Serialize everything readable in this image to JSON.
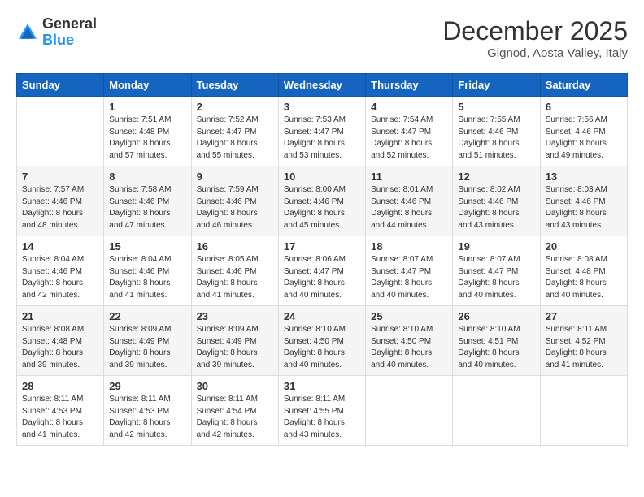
{
  "header": {
    "logo_line1": "General",
    "logo_line2": "Blue",
    "month_title": "December 2025",
    "location": "Gignod, Aosta Valley, Italy"
  },
  "days_of_week": [
    "Sunday",
    "Monday",
    "Tuesday",
    "Wednesday",
    "Thursday",
    "Friday",
    "Saturday"
  ],
  "weeks": [
    [
      {
        "day": "",
        "sunrise": "",
        "sunset": "",
        "daylight": ""
      },
      {
        "day": "1",
        "sunrise": "Sunrise: 7:51 AM",
        "sunset": "Sunset: 4:48 PM",
        "daylight": "Daylight: 8 hours and 57 minutes."
      },
      {
        "day": "2",
        "sunrise": "Sunrise: 7:52 AM",
        "sunset": "Sunset: 4:47 PM",
        "daylight": "Daylight: 8 hours and 55 minutes."
      },
      {
        "day": "3",
        "sunrise": "Sunrise: 7:53 AM",
        "sunset": "Sunset: 4:47 PM",
        "daylight": "Daylight: 8 hours and 53 minutes."
      },
      {
        "day": "4",
        "sunrise": "Sunrise: 7:54 AM",
        "sunset": "Sunset: 4:47 PM",
        "daylight": "Daylight: 8 hours and 52 minutes."
      },
      {
        "day": "5",
        "sunrise": "Sunrise: 7:55 AM",
        "sunset": "Sunset: 4:46 PM",
        "daylight": "Daylight: 8 hours and 51 minutes."
      },
      {
        "day": "6",
        "sunrise": "Sunrise: 7:56 AM",
        "sunset": "Sunset: 4:46 PM",
        "daylight": "Daylight: 8 hours and 49 minutes."
      }
    ],
    [
      {
        "day": "7",
        "sunrise": "Sunrise: 7:57 AM",
        "sunset": "Sunset: 4:46 PM",
        "daylight": "Daylight: 8 hours and 48 minutes."
      },
      {
        "day": "8",
        "sunrise": "Sunrise: 7:58 AM",
        "sunset": "Sunset: 4:46 PM",
        "daylight": "Daylight: 8 hours and 47 minutes."
      },
      {
        "day": "9",
        "sunrise": "Sunrise: 7:59 AM",
        "sunset": "Sunset: 4:46 PM",
        "daylight": "Daylight: 8 hours and 46 minutes."
      },
      {
        "day": "10",
        "sunrise": "Sunrise: 8:00 AM",
        "sunset": "Sunset: 4:46 PM",
        "daylight": "Daylight: 8 hours and 45 minutes."
      },
      {
        "day": "11",
        "sunrise": "Sunrise: 8:01 AM",
        "sunset": "Sunset: 4:46 PM",
        "daylight": "Daylight: 8 hours and 44 minutes."
      },
      {
        "day": "12",
        "sunrise": "Sunrise: 8:02 AM",
        "sunset": "Sunset: 4:46 PM",
        "daylight": "Daylight: 8 hours and 43 minutes."
      },
      {
        "day": "13",
        "sunrise": "Sunrise: 8:03 AM",
        "sunset": "Sunset: 4:46 PM",
        "daylight": "Daylight: 8 hours and 43 minutes."
      }
    ],
    [
      {
        "day": "14",
        "sunrise": "Sunrise: 8:04 AM",
        "sunset": "Sunset: 4:46 PM",
        "daylight": "Daylight: 8 hours and 42 minutes."
      },
      {
        "day": "15",
        "sunrise": "Sunrise: 8:04 AM",
        "sunset": "Sunset: 4:46 PM",
        "daylight": "Daylight: 8 hours and 41 minutes."
      },
      {
        "day": "16",
        "sunrise": "Sunrise: 8:05 AM",
        "sunset": "Sunset: 4:46 PM",
        "daylight": "Daylight: 8 hours and 41 minutes."
      },
      {
        "day": "17",
        "sunrise": "Sunrise: 8:06 AM",
        "sunset": "Sunset: 4:47 PM",
        "daylight": "Daylight: 8 hours and 40 minutes."
      },
      {
        "day": "18",
        "sunrise": "Sunrise: 8:07 AM",
        "sunset": "Sunset: 4:47 PM",
        "daylight": "Daylight: 8 hours and 40 minutes."
      },
      {
        "day": "19",
        "sunrise": "Sunrise: 8:07 AM",
        "sunset": "Sunset: 4:47 PM",
        "daylight": "Daylight: 8 hours and 40 minutes."
      },
      {
        "day": "20",
        "sunrise": "Sunrise: 8:08 AM",
        "sunset": "Sunset: 4:48 PM",
        "daylight": "Daylight: 8 hours and 40 minutes."
      }
    ],
    [
      {
        "day": "21",
        "sunrise": "Sunrise: 8:08 AM",
        "sunset": "Sunset: 4:48 PM",
        "daylight": "Daylight: 8 hours and 39 minutes."
      },
      {
        "day": "22",
        "sunrise": "Sunrise: 8:09 AM",
        "sunset": "Sunset: 4:49 PM",
        "daylight": "Daylight: 8 hours and 39 minutes."
      },
      {
        "day": "23",
        "sunrise": "Sunrise: 8:09 AM",
        "sunset": "Sunset: 4:49 PM",
        "daylight": "Daylight: 8 hours and 39 minutes."
      },
      {
        "day": "24",
        "sunrise": "Sunrise: 8:10 AM",
        "sunset": "Sunset: 4:50 PM",
        "daylight": "Daylight: 8 hours and 40 minutes."
      },
      {
        "day": "25",
        "sunrise": "Sunrise: 8:10 AM",
        "sunset": "Sunset: 4:50 PM",
        "daylight": "Daylight: 8 hours and 40 minutes."
      },
      {
        "day": "26",
        "sunrise": "Sunrise: 8:10 AM",
        "sunset": "Sunset: 4:51 PM",
        "daylight": "Daylight: 8 hours and 40 minutes."
      },
      {
        "day": "27",
        "sunrise": "Sunrise: 8:11 AM",
        "sunset": "Sunset: 4:52 PM",
        "daylight": "Daylight: 8 hours and 41 minutes."
      }
    ],
    [
      {
        "day": "28",
        "sunrise": "Sunrise: 8:11 AM",
        "sunset": "Sunset: 4:53 PM",
        "daylight": "Daylight: 8 hours and 41 minutes."
      },
      {
        "day": "29",
        "sunrise": "Sunrise: 8:11 AM",
        "sunset": "Sunset: 4:53 PM",
        "daylight": "Daylight: 8 hours and 42 minutes."
      },
      {
        "day": "30",
        "sunrise": "Sunrise: 8:11 AM",
        "sunset": "Sunset: 4:54 PM",
        "daylight": "Daylight: 8 hours and 42 minutes."
      },
      {
        "day": "31",
        "sunrise": "Sunrise: 8:11 AM",
        "sunset": "Sunset: 4:55 PM",
        "daylight": "Daylight: 8 hours and 43 minutes."
      },
      {
        "day": "",
        "sunrise": "",
        "sunset": "",
        "daylight": ""
      },
      {
        "day": "",
        "sunrise": "",
        "sunset": "",
        "daylight": ""
      },
      {
        "day": "",
        "sunrise": "",
        "sunset": "",
        "daylight": ""
      }
    ]
  ]
}
